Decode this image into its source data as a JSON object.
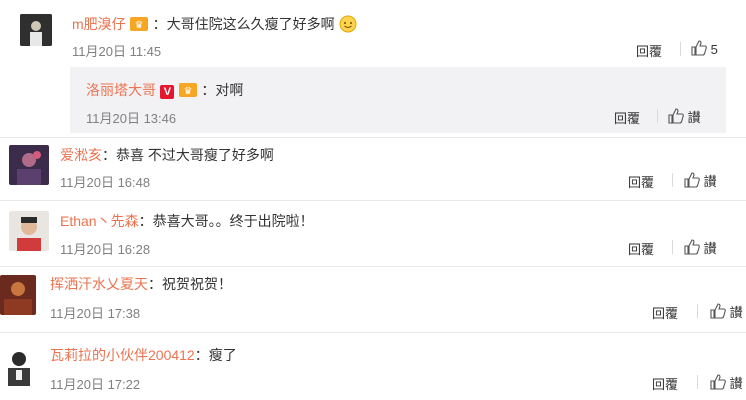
{
  "comments": [
    {
      "user": "m肥溴仔",
      "text": "大哥住院这么久瘦了好多啊",
      "time": "11月20日 11:45",
      "reply_label": "回覆",
      "like_count": "5"
    },
    {
      "user": "洛丽塔大哥",
      "text": "对啊",
      "time": "11月20日 13:46",
      "reply_label": "回覆",
      "like_label": "讃"
    },
    {
      "user": "爱淞亥",
      "text": "恭喜 不过大哥瘦了好多啊",
      "time": "11月20日 16:48",
      "reply_label": "回覆",
      "like_label": "讃"
    },
    {
      "user": "Ethan丶先森",
      "text": "恭喜大哥。。终于出院啦！",
      "time": "11月20日 16:28",
      "reply_label": "回覆",
      "like_label": "讃"
    },
    {
      "user": "挥洒汗水乂夏天",
      "text": "祝贺祝贺！",
      "time": "11月20日 17:38",
      "reply_label": "回覆",
      "like_label": "讃"
    },
    {
      "user": "瓦莉拉的小伙伴200412",
      "text": "瘦了",
      "time": "11月20日 17:22",
      "reply_label": "回覆",
      "like_label": "讃"
    }
  ],
  "separator": "：",
  "colors": {
    "username": "#eb7350",
    "reply_bg": "#f2f2f5",
    "verified_badge": "#e6162d"
  },
  "icons": {
    "like": "thumbs-up-icon",
    "verified": "verified-v-icon",
    "member": "member-crown-icon",
    "emoji": "smile-emoji-icon"
  }
}
